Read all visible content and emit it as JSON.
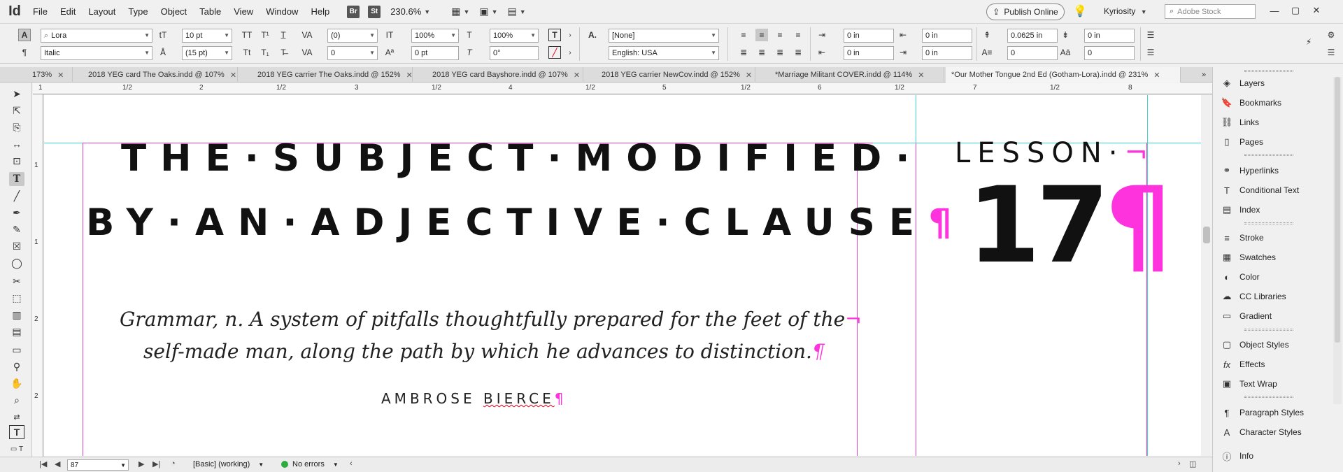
{
  "app": {
    "logo": "Id"
  },
  "menu": [
    "File",
    "Edit",
    "Layout",
    "Type",
    "Object",
    "Table",
    "View",
    "Window",
    "Help"
  ],
  "menubar": {
    "bridge": "Br",
    "stock_btn": "St",
    "zoom": "230.6%",
    "publish": "Publish Online",
    "workspace": "Kyriosity",
    "search_placeholder": "Adobe Stock"
  },
  "control": {
    "font_family": "Lora",
    "font_style": "Italic",
    "font_size": "10 pt",
    "leading": "(15 pt)",
    "kerning": "(0)",
    "tracking": "0",
    "vscale": "100%",
    "hscale": "100%",
    "baseline": "0 pt",
    "skew": "0°",
    "char_style": "[None]",
    "language": "English: USA",
    "left_indent": "0 in",
    "first_indent": "0 in",
    "right_indent": "0 in",
    "last_indent": "0 in",
    "space_before": "0.0625 in",
    "space_after": "0 in",
    "drop_lines": "0",
    "drop_chars": "0",
    "icons": {
      "char_mode": "A",
      "para_mode": "¶"
    }
  },
  "tabs": [
    {
      "label": "173%"
    },
    {
      "label": "2018 YEG card The Oaks.indd @ 107%"
    },
    {
      "label": "2018 YEG carrier The Oaks.indd @ 152%"
    },
    {
      "label": "2018 YEG card Bayshore.indd @ 107%"
    },
    {
      "label": "2018 YEG carrier NewCov.indd @ 152%"
    },
    {
      "label": "*Marriage Militant COVER.indd @ 114%"
    },
    {
      "label": "*Our Mother Tongue 2nd Ed (Gotham-Lora).indd @ 231%"
    }
  ],
  "ruler": {
    "h_labels": [
      "1",
      "1/2",
      "2",
      "1/2",
      "3",
      "1/2",
      "4",
      "1/2",
      "5",
      "1/2",
      "6",
      "1/2",
      "7",
      "1/2",
      "8"
    ],
    "v_labels": [
      "1",
      "1",
      "2",
      "2"
    ]
  },
  "document": {
    "headline_line1": "THE·SUBJECT·MODIFIED·",
    "headline_line2": "BY·AN·ADJECTIVE·CLAUSE",
    "lesson_label": "LESSON·",
    "lesson_number": "17",
    "quote_line1": "Grammar, n. A system of pitfalls thoughtfully prepared for the feet of the",
    "quote_line2": "self-made man, along the path by which he advances to distinction.",
    "author_first": "AMBROSE ",
    "author_last": "BIERCE",
    "pilcrow": "¶",
    "line_end": "¬"
  },
  "status": {
    "page": "87",
    "preflight_profile": "[Basic] (working)",
    "errors": "No errors"
  },
  "panels": [
    {
      "label": "Layers",
      "icon": "layers-icon"
    },
    {
      "label": "Bookmarks",
      "icon": "bookmark-icon"
    },
    {
      "label": "Links",
      "icon": "links-icon"
    },
    {
      "label": "Pages",
      "icon": "pages-icon"
    },
    {
      "label": "Hyperlinks",
      "icon": "hyperlinks-icon"
    },
    {
      "label": "Conditional Text",
      "icon": "conditional-text-icon"
    },
    {
      "label": "Index",
      "icon": "index-icon"
    },
    {
      "label": "Stroke",
      "icon": "stroke-icon"
    },
    {
      "label": "Swatches",
      "icon": "swatches-icon"
    },
    {
      "label": "Color",
      "icon": "color-icon"
    },
    {
      "label": "CC Libraries",
      "icon": "cc-libraries-icon"
    },
    {
      "label": "Gradient",
      "icon": "gradient-icon"
    },
    {
      "label": "Object Styles",
      "icon": "object-styles-icon"
    },
    {
      "label": "Effects",
      "icon": "effects-icon"
    },
    {
      "label": "Text Wrap",
      "icon": "text-wrap-icon"
    },
    {
      "label": "Paragraph Styles",
      "icon": "paragraph-styles-icon"
    },
    {
      "label": "Character Styles",
      "icon": "character-styles-icon"
    },
    {
      "label": "Info",
      "icon": "info-icon"
    }
  ],
  "colors": {
    "guide": "#42d6d0",
    "frame_edge": "#e040c8",
    "hidden_chars": "#ff33dd",
    "status_ok": "#2dad3f"
  }
}
